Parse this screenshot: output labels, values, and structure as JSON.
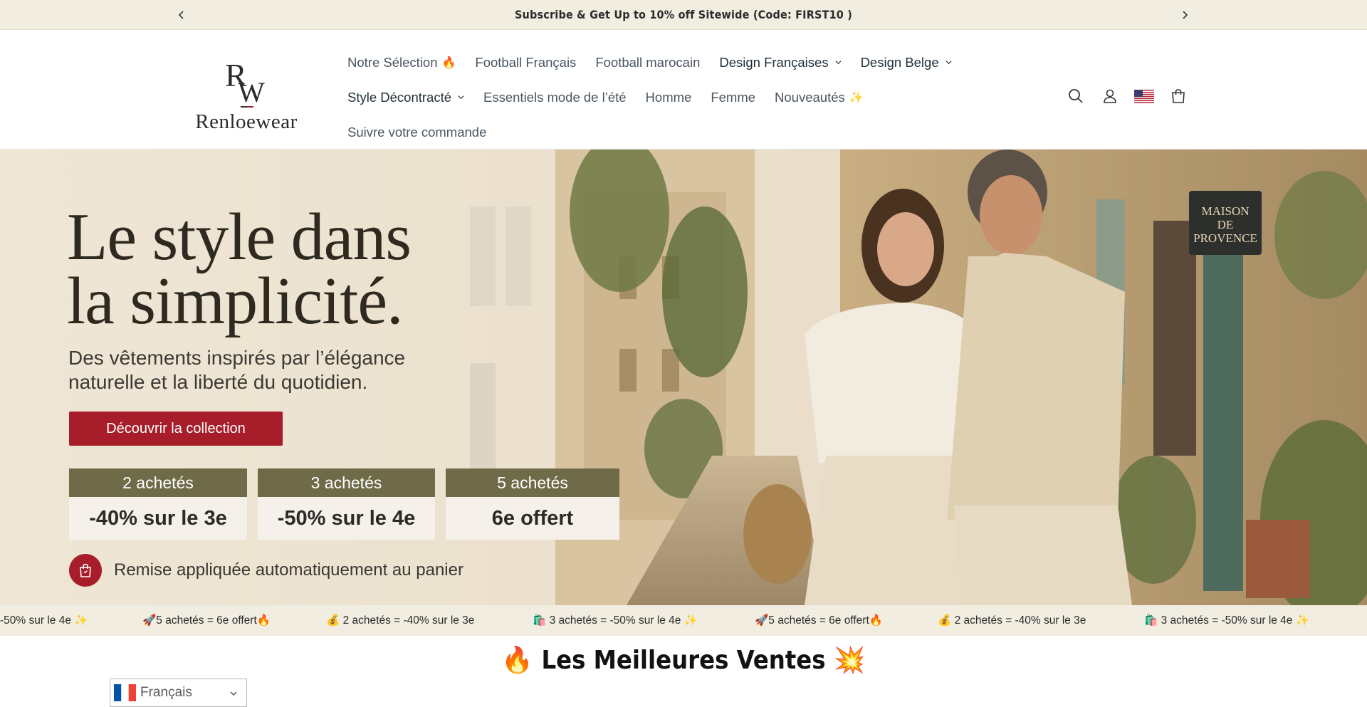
{
  "announcement": {
    "text": "Subscribe & Get Up to 10% off Sitewide (Code: FIRST10 )"
  },
  "brand": {
    "monogram": "RW",
    "name": "Renloewear"
  },
  "nav": {
    "row1": [
      {
        "label": "Notre Sélection",
        "emoji": "🔥",
        "dropdown": false
      },
      {
        "label": "Football Français",
        "dropdown": false
      },
      {
        "label": "Football marocain",
        "dropdown": false
      },
      {
        "label": "Design Françaises",
        "dropdown": true
      },
      {
        "label": "Design Belge",
        "dropdown": true
      }
    ],
    "row2": [
      {
        "label": "Style Décontracté",
        "dropdown": true
      },
      {
        "label": "Essentiels mode de l’été",
        "dropdown": false
      },
      {
        "label": "Homme",
        "dropdown": false
      },
      {
        "label": "Femme",
        "dropdown": false
      },
      {
        "label": "Nouveautés",
        "emoji": "✨",
        "dropdown": false
      }
    ],
    "row3": [
      {
        "label": "Suivre votre commande",
        "dropdown": false
      }
    ]
  },
  "header_icons": [
    "search-icon",
    "account-icon",
    "us-flag-icon",
    "cart-icon"
  ],
  "hero": {
    "title_line1": "Le style dans",
    "title_line2": "la simplicité.",
    "subtitle_line1": "Des vêtements inspirés par l’élégance",
    "subtitle_line2": "naturelle et la liberté du quotidien.",
    "cta": "Découvrir la collection",
    "sign_line1": "MAISON",
    "sign_line2": "DE",
    "sign_line3": "PROVENCE",
    "offers": [
      {
        "head": "2 achetés",
        "body": "-40% sur le 3e"
      },
      {
        "head": "3 achetés",
        "body": "-50% sur le 4e"
      },
      {
        "head": "5 achetés",
        "body": "6e offert"
      }
    ],
    "remise": "Remise appliquée automatiquement au panier"
  },
  "ticker": [
    "-50% sur le 4e ✨",
    "🚀5 achetés = 6e offert🔥",
    "💰 2 achetés = -40% sur le 3e",
    "🛍️ 3 achetés = -50% sur le 4e ✨",
    "🚀5 achetés = 6e offert🔥",
    "💰 2 achetés = -40% sur le 3e",
    "🛍️ 3 achetés = -50% sur le 4e ✨"
  ],
  "best_sellers": {
    "title": "🔥 Les Meilleures Ventes 💥"
  },
  "language": {
    "selected": "Français"
  },
  "colors": {
    "announcement_bg": "#f1ede1",
    "accent_red": "#a81d2a",
    "offer_head": "#6f6a47"
  }
}
